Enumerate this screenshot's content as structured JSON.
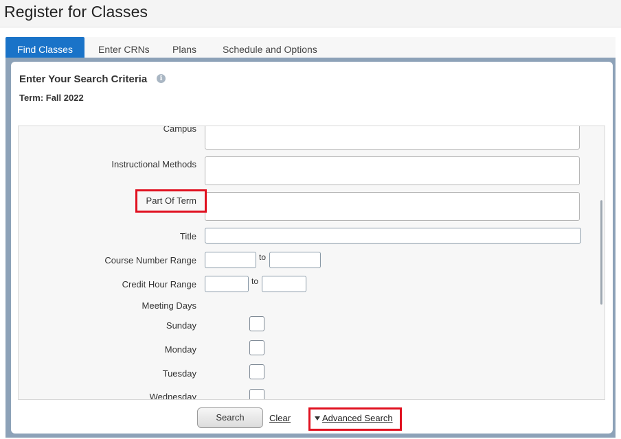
{
  "app": {
    "title": "Register for Classes"
  },
  "tabs": [
    {
      "label": "Find Classes",
      "active": true
    },
    {
      "label": "Enter CRNs",
      "active": false
    },
    {
      "label": "Plans",
      "active": false
    },
    {
      "label": "Schedule and Options",
      "active": false
    }
  ],
  "criteria": {
    "heading": "Enter Your Search Criteria",
    "info_icon": "info-icon",
    "term": "Term: Fall 2022"
  },
  "form": {
    "campus_label": "Campus",
    "instructional_methods_label": "Instructional Methods",
    "part_of_term_label": "Part Of Term",
    "title_label": "Title",
    "title_value": "",
    "course_number_range_label": "Course Number Range",
    "course_to_label": "to",
    "credit_hour_range_label": "Credit Hour Range",
    "credit_to_label": "to",
    "meeting_days_label": "Meeting Days",
    "days": [
      "Sunday",
      "Monday",
      "Tuesday",
      "Wednesday"
    ]
  },
  "actions": {
    "search_label": "Search",
    "clear_label": "Clear",
    "advanced_search_label": "Advanced Search"
  },
  "colors": {
    "active_tab": "#1a73c8",
    "panel_frame": "#8da2b8",
    "highlight": "#e0101f"
  }
}
